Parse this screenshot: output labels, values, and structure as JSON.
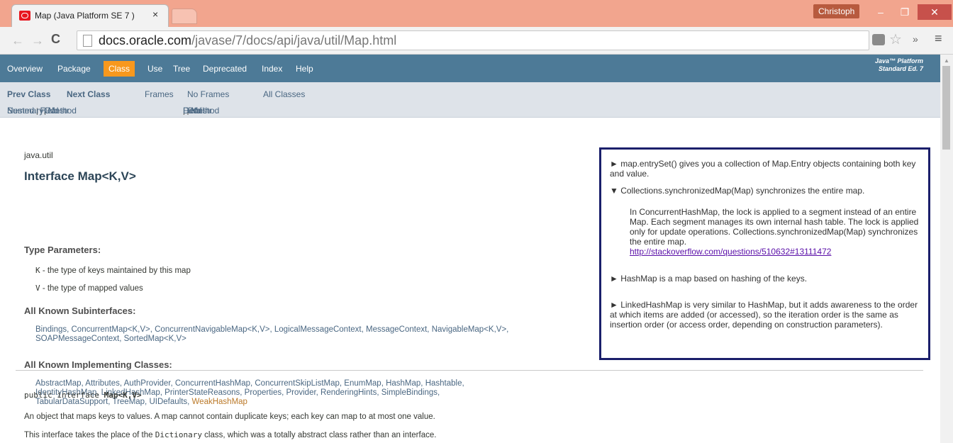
{
  "browser": {
    "tab_title": "Map (Java Platform SE 7 )",
    "tab_close": "×",
    "user_name": "Christoph",
    "window_min": "‒",
    "window_max": "❐",
    "window_close": "✕",
    "back": "←",
    "forward": "→",
    "reload": "C",
    "url_domain": "docs.oracle.com",
    "url_path": "/javase/7/docs/api/java/util/Map.html",
    "star": "☆",
    "more": "»",
    "menu": "≡"
  },
  "topnav": {
    "overview": "Overview",
    "package": "Package",
    "class": "Class",
    "use": "Use",
    "tree": "Tree",
    "deprecated": "Deprecated",
    "index": "Index",
    "help": "Help",
    "platform_line1": "Java™ Platform",
    "platform_line2": "Standard Ed. 7"
  },
  "subnav": {
    "prev_class": "Prev Class",
    "next_class": "Next Class",
    "frames": "Frames",
    "no_frames": "No Frames",
    "all_classes": "All Classes",
    "summary_label": "Summary:",
    "summary_nested": "Nested",
    "summary_field": "Field",
    "summary_constr": "Constr",
    "summary_method": "Method",
    "detail_label": "Detail:",
    "detail_field": "Field",
    "detail_constr": "Constr",
    "detail_method": "Method"
  },
  "content": {
    "package_name": "java.util",
    "title": "Interface Map<K,V>",
    "type_params_heading": "Type Parameters:",
    "type_param_k_name": "K",
    "type_param_k_desc": " - the type of keys maintained by this map",
    "type_param_v_name": "V",
    "type_param_v_desc": " - the type of mapped values",
    "subinterfaces_heading": "All Known Subinterfaces:",
    "subinterfaces_line1": "Bindings, ConcurrentMap<K,V>, ConcurrentNavigableMap<K,V>, LogicalMessageContext, MessageContext, NavigableMap<K,V>,",
    "subinterfaces_line2": "SOAPMessageContext, SortedMap<K,V>",
    "implementing_heading": "All Known Implementing Classes:",
    "implementing_line1": "AbstractMap, Attributes, AuthProvider, ConcurrentHashMap, ConcurrentSkipListMap, EnumMap, HashMap, Hashtable,",
    "implementing_line2": "IdentityHashMap, LinkedHashMap, PrinterStateReasons, Properties, Provider, RenderingHints, SimpleBindings,",
    "implementing_line3": "TabularDataSupport, TreeMap, UIDefaults, ",
    "implementing_visited": "WeakHashMap",
    "signature_prefix": "public interface ",
    "signature_name": "Map<K,V>",
    "desc1": "An object that maps keys to values. A map cannot contain duplicate keys; each key can map to at most one value.",
    "desc2_pre": "This interface takes the place of the ",
    "desc2_code": "Dictionary",
    "desc2_post": " class, which was a totally abstract class rather than an interface."
  },
  "notes": {
    "n1": "► map.entrySet() gives you a collection of Map.Entry objects containing both key and value.",
    "n2": "▼ Collections.synchronizedMap(Map) synchronizes the entire map.",
    "n2_detail": "In ConcurrentHashMap, the lock is applied to a segment instead of an entire Map. Each segment manages its own internal hash table. The lock is applied only for update operations. Collections.synchronizedMap(Map) synchronizes the entire map.",
    "n2_link": "http://stackoverflow.com/questions/510632#13111472",
    "n3": "► HashMap is a map based on hashing of the keys.",
    "n4": "► LinkedHashMap is very similar to HashMap, but it adds awareness to the order at which items are added (or accessed), so the iteration order is the same as insertion order (or access order, depending on construction parameters)."
  },
  "colors": {
    "titlebar": "#f2a58e",
    "nav_bar": "#4d7a97",
    "active_tab": "#f8981d",
    "subnav": "#dee3e9",
    "note_border": "#1b1f6b"
  }
}
